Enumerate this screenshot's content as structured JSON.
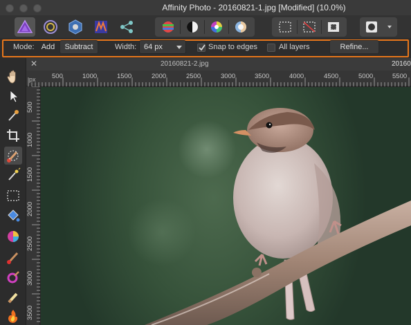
{
  "window": {
    "title": "Affinity Photo - 20160821-1.jpg [Modified] (10.0%)"
  },
  "context_toolbar": {
    "mode_label": "Mode:",
    "add_label": "Add",
    "subtract_label": "Subtract",
    "width_label": "Width:",
    "width_value": "64 px",
    "snap_label": "Snap to edges",
    "snap_checked": true,
    "all_layers_label": "All layers",
    "all_layers_checked": false,
    "refine_label": "Refine..."
  },
  "tabs": [
    {
      "label": "20160821-2.jpg"
    },
    {
      "label": "20160"
    }
  ],
  "ruler": {
    "unit": "px",
    "top_ticks": [
      "500",
      "1000",
      "1500",
      "2000",
      "2500",
      "3000",
      "3500",
      "4000",
      "4500",
      "5000",
      "5500"
    ],
    "left_ticks": [
      "500",
      "1000",
      "1500",
      "2000",
      "2500",
      "3000",
      "3500"
    ]
  },
  "colors": {
    "accent": "#e8771b",
    "canvas_green": "#3d5a40"
  },
  "icons": {
    "personas": [
      "photo-persona-icon",
      "liquify-persona-icon",
      "develop-persona-icon",
      "tone-mapping-persona-icon",
      "export-persona-icon"
    ],
    "adjustments": [
      "hsl-icon",
      "black-white-icon",
      "color-wheel-icon",
      "white-balance-icon"
    ],
    "selection": [
      "select-all-icon",
      "deselect-icon",
      "invert-selection-icon"
    ],
    "tools": [
      "hand-icon",
      "move-icon",
      "color-picker-icon",
      "crop-icon",
      "selection-brush-icon",
      "flood-select-icon",
      "marquee-icon",
      "paint-bucket-icon",
      "gradient-icon",
      "paint-brush-icon",
      "mixer-brush-icon",
      "dodge-icon",
      "burn-icon"
    ]
  }
}
